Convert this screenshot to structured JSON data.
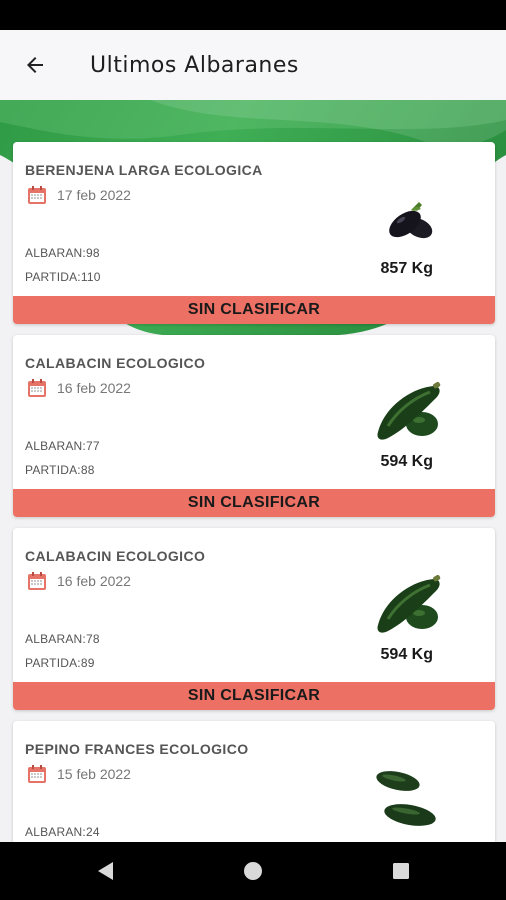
{
  "colors": {
    "status_badge": "#ec7063",
    "hero_green": "#3aa34f",
    "calendar_red": "#e57368"
  },
  "app_bar": {
    "title": "Ultimos Albaranes",
    "back_icon": "arrow-left-icon"
  },
  "cards": [
    {
      "product": "BERENJENA LARGA ECOLOGICA",
      "date": "17 feb 2022",
      "albaran": "ALBARAN:98",
      "partida": "PARTIDA:110",
      "weight": "857 Kg",
      "status": "SIN CLASIFICAR",
      "image": "eggplant-image"
    },
    {
      "product": "CALABACIN ECOLOGICO",
      "date": "16 feb 2022",
      "albaran": "ALBARAN:77",
      "partida": "PARTIDA:88",
      "weight": "594 Kg",
      "status": "SIN CLASIFICAR",
      "image": "zucchini-image"
    },
    {
      "product": "CALABACIN ECOLOGICO",
      "date": "16 feb 2022",
      "albaran": "ALBARAN:78",
      "partida": "PARTIDA:89",
      "weight": "594 Kg",
      "status": "SIN CLASIFICAR",
      "image": "zucchini-image"
    },
    {
      "product": "PEPINO FRANCES ECOLOGICO",
      "date": "15 feb 2022",
      "albaran": "ALBARAN:24",
      "partida": "",
      "weight": "",
      "status": "",
      "image": "cucumber-image"
    }
  ],
  "nav_bar": {
    "back_icon": "nav-back-icon",
    "home_icon": "nav-home-icon",
    "recents_icon": "nav-recents-icon"
  }
}
